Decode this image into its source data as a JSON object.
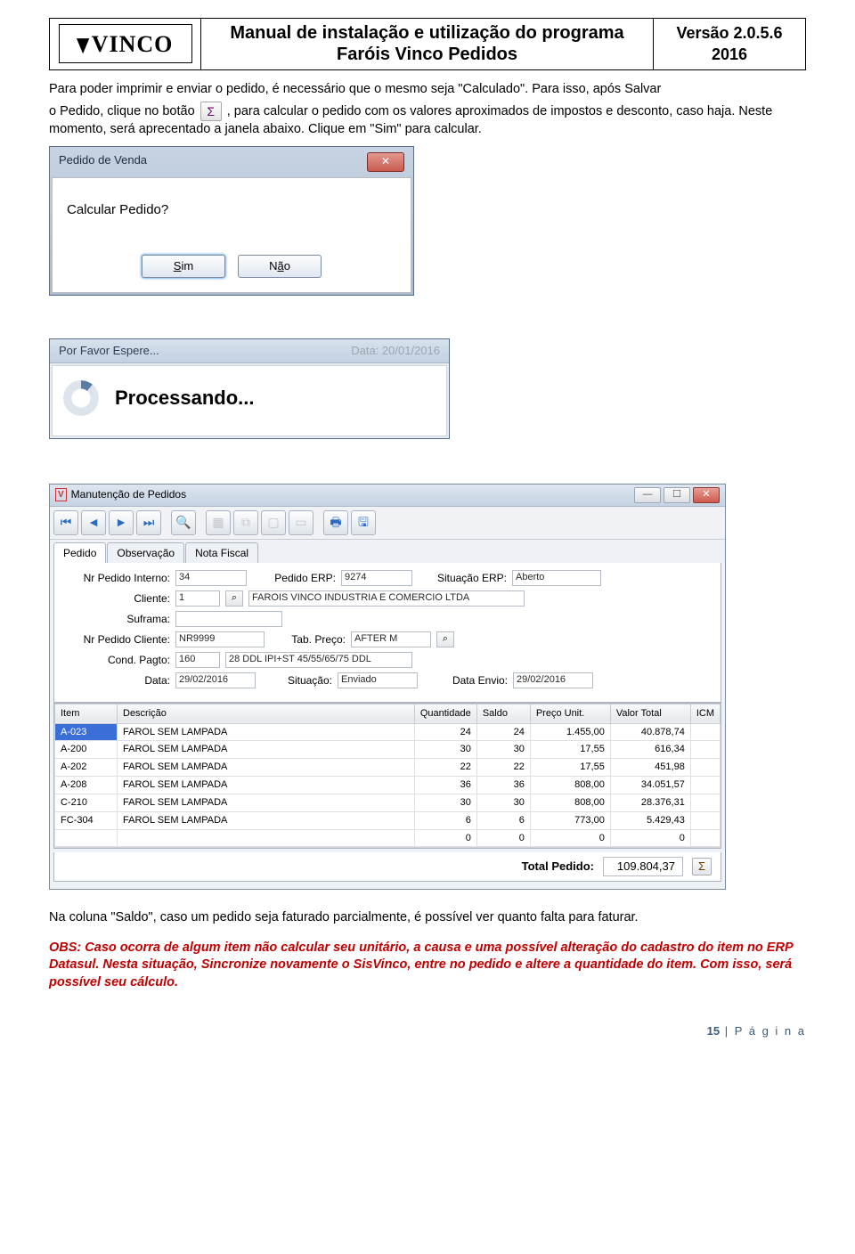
{
  "header": {
    "logo_text": "VINCO",
    "title": "Manual de instalação e utilização do programa Faróis Vinco Pedidos",
    "version_line1": "Versão 2.0.5.6",
    "version_line2": "2016"
  },
  "para1": "Para poder imprimir e enviar o pedido, é necessário que o mesmo seja \"Calculado\". Para isso, após Salvar",
  "para2_prefix": "o Pedido, clique no botão ",
  "para2_suffix": ", para calcular o pedido com os valores aproximados de impostos e desconto, caso haja. Neste momento, será aprecentado a janela abaixo. Clique em \"Sim\" para calcular.",
  "dialog1": {
    "title": "Pedido de Venda",
    "message": "Calcular Pedido?",
    "btn_sim": "Sim",
    "btn_nao_prefix": "N",
    "btn_nao_rest": "ão"
  },
  "dialog2": {
    "title": "Por Favor Espere...",
    "data_label": "Data:",
    "data_value": "20/01/2016",
    "processing": "Processando..."
  },
  "bigwin": {
    "title": "Manutenção de Pedidos",
    "tabs": [
      "Pedido",
      "Observação",
      "Nota Fiscal"
    ],
    "labels": {
      "nr_pedido_interno": "Nr Pedido Interno:",
      "pedido_erp": "Pedido ERP:",
      "situacao_erp": "Situação ERP:",
      "cliente": "Cliente:",
      "suframa": "Suframa:",
      "nr_pedido_cliente": "Nr Pedido Cliente:",
      "tab_preco": "Tab. Preço:",
      "cond_pagto": "Cond. Pagto:",
      "data": "Data:",
      "situacao": "Situação:",
      "data_envio": "Data Envio:"
    },
    "values": {
      "nr_pedido_interno": "34",
      "pedido_erp": "9274",
      "situacao_erp": "Aberto",
      "cliente_cod": "1",
      "cliente_nome": "FAROIS VINCO INDUSTRIA E COMERCIO LTDA",
      "suframa": "",
      "nr_pedido_cliente": "NR9999",
      "tab_preco": "AFTER M",
      "cond_pagto_cod": "160",
      "cond_pagto_desc": "28 DDL IPI+ST 45/55/65/75 DDL",
      "data": "29/02/2016",
      "situacao": "Enviado",
      "data_envio": "29/02/2016"
    },
    "columns": [
      "Item",
      "Descrição",
      "Quantidade",
      "Saldo",
      "Preço Unit.",
      "Valor Total",
      "ICM"
    ],
    "rows": [
      {
        "item": "A-023",
        "desc": "FAROL SEM LAMPADA",
        "qtd": "24",
        "saldo": "24",
        "unit": "1.455,00",
        "total": "40.878,74"
      },
      {
        "item": "A-200",
        "desc": "FAROL SEM LAMPADA",
        "qtd": "30",
        "saldo": "30",
        "unit": "17,55",
        "total": "616,34"
      },
      {
        "item": "A-202",
        "desc": "FAROL SEM LAMPADA",
        "qtd": "22",
        "saldo": "22",
        "unit": "17,55",
        "total": "451,98"
      },
      {
        "item": "A-208",
        "desc": "FAROL SEM LAMPADA",
        "qtd": "36",
        "saldo": "36",
        "unit": "808,00",
        "total": "34.051,57"
      },
      {
        "item": "C-210",
        "desc": "FAROL SEM LAMPADA",
        "qtd": "30",
        "saldo": "30",
        "unit": "808,00",
        "total": "28.376,31"
      },
      {
        "item": "FC-304",
        "desc": "FAROL SEM LAMPADA",
        "qtd": "6",
        "saldo": "6",
        "unit": "773,00",
        "total": "5.429,43"
      },
      {
        "item": "",
        "desc": "",
        "qtd": "0",
        "saldo": "0",
        "unit": "0",
        "total": "0"
      }
    ],
    "total_label": "Total Pedido:",
    "total_value": "109.804,37"
  },
  "para3": "Na coluna \"Saldo\", caso um pedido seja faturado parcialmente, é possível ver quanto falta para faturar.",
  "obs": "OBS: Caso ocorra de algum item não calcular seu unitário, a causa e uma possível alteração do cadastro do item no ERP Datasul. Nesta situação, Sincronize novamente o SisVinco, entre no pedido e altere a quantidade do item. Com isso, será possível seu cálculo.",
  "footer_page_num": "15",
  "footer_page_text": " | P á g i n a"
}
